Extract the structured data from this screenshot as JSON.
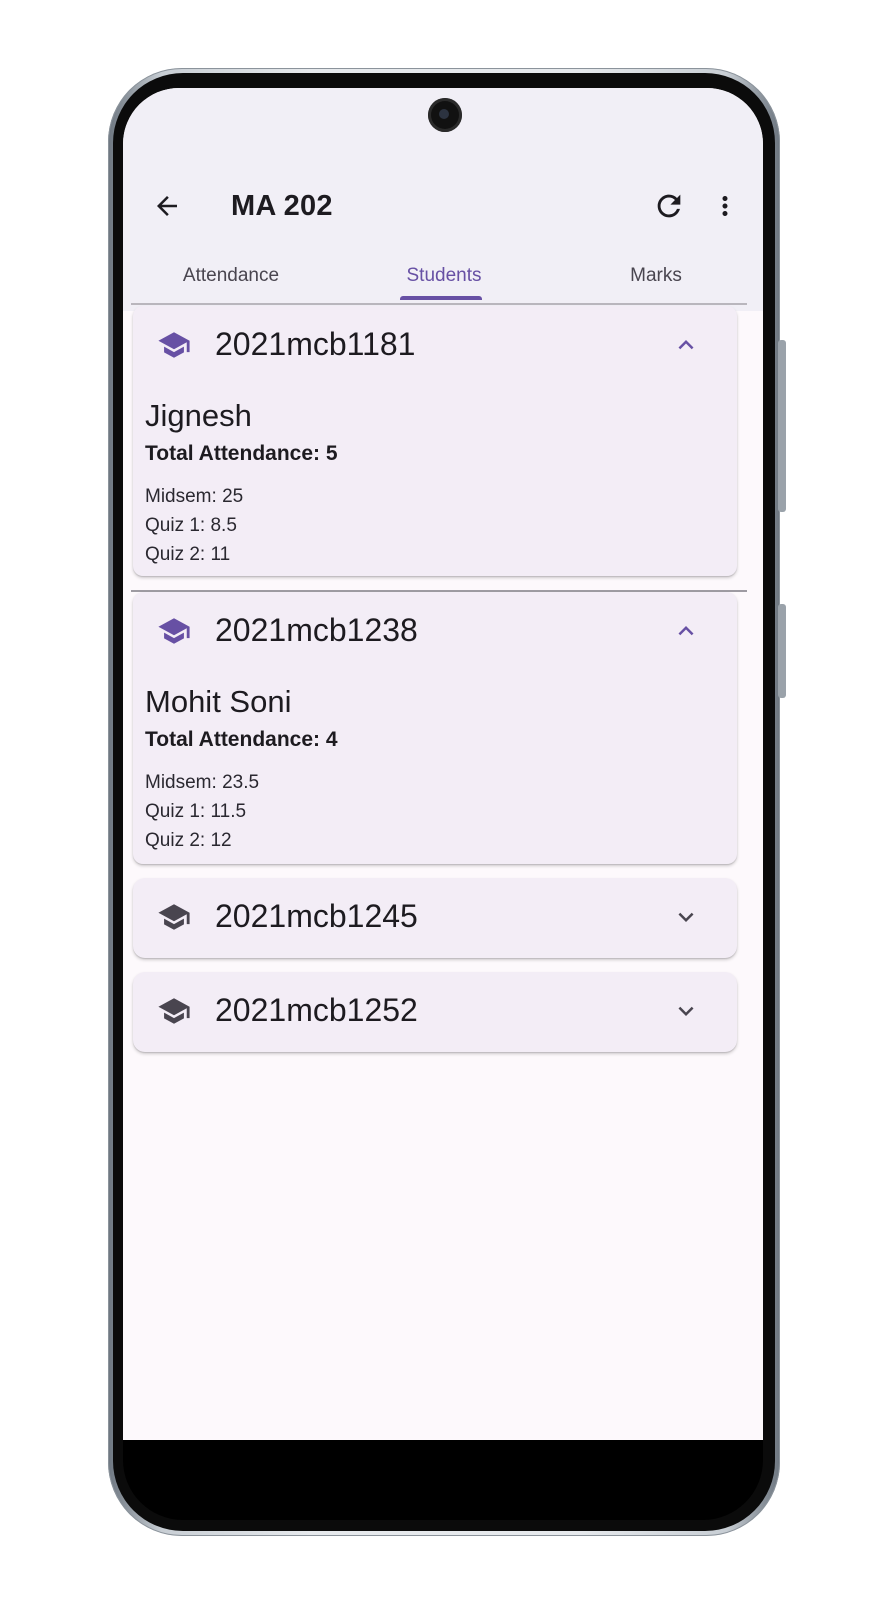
{
  "appbar": {
    "title": "MA 202",
    "back_icon": "arrow-back-icon",
    "refresh_icon": "refresh-icon",
    "more_icon": "more-vert-icon"
  },
  "tabs": [
    {
      "label": "Attendance",
      "selected": false
    },
    {
      "label": "Students",
      "selected": true
    },
    {
      "label": "Marks",
      "selected": false
    }
  ],
  "colors": {
    "accent": "#6750a4",
    "card_bg": "#f3edf6",
    "appbar_bg": "#f1eff6",
    "text": "#1d1b20"
  },
  "students": [
    {
      "id": "2021mcb1181",
      "expanded": true,
      "name": "Jignesh",
      "total_attendance": "Total Attendance: 5",
      "marks": [
        "Midsem: 25",
        "Quiz 1: 8.5",
        "Quiz 2: 11"
      ]
    },
    {
      "id": "2021mcb1238",
      "expanded": true,
      "name": "Mohit Soni",
      "total_attendance": "Total Attendance: 4",
      "marks": [
        "Midsem: 23.5",
        "Quiz 1: 11.5",
        "Quiz 2: 12"
      ]
    },
    {
      "id": "2021mcb1245",
      "expanded": false
    },
    {
      "id": "2021mcb1252",
      "expanded": false
    }
  ]
}
